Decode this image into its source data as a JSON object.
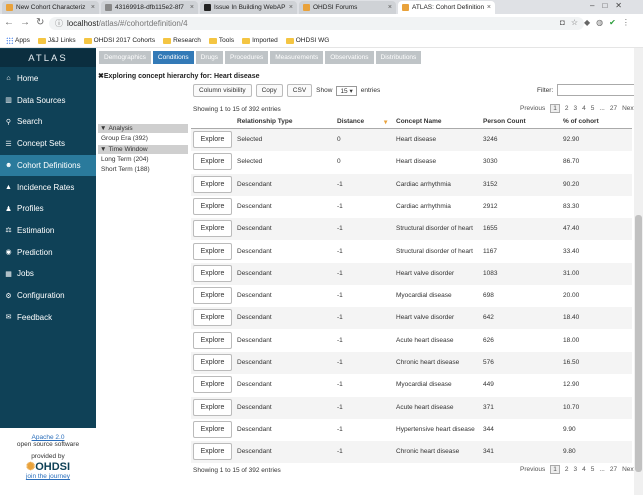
{
  "browser": {
    "tabs": [
      {
        "title": "New Cohort Characteriz",
        "color": "#e9a23b"
      },
      {
        "title": "43169918-dfb115e2-8f7",
        "color": "#888888"
      },
      {
        "title": "Issue In Building WebAP",
        "color": "#222222"
      },
      {
        "title": "OHDSI Forums",
        "color": "#e9a23b"
      },
      {
        "title": "ATLAS: Cohort Definition",
        "color": "#e9a23b"
      }
    ],
    "url_host": "localhost",
    "url_path": "/atlas/#/cohortdefinition/4",
    "bookmarks": [
      "Apps",
      "J&J Links",
      "OHDSI 2017 Cohorts",
      "Research",
      "Tools",
      "Imported",
      "OHDSI WG"
    ]
  },
  "sidebar": {
    "logo": "ATLAS",
    "items": [
      {
        "label": "Home",
        "icon": "⌂"
      },
      {
        "label": "Data Sources",
        "icon": "▥"
      },
      {
        "label": "Search",
        "icon": "⚲"
      },
      {
        "label": "Concept Sets",
        "icon": "☰"
      },
      {
        "label": "Cohort Definitions",
        "icon": "☻"
      },
      {
        "label": "Incidence Rates",
        "icon": "▲"
      },
      {
        "label": "Profiles",
        "icon": "♟"
      },
      {
        "label": "Estimation",
        "icon": "⚖"
      },
      {
        "label": "Prediction",
        "icon": "◉"
      },
      {
        "label": "Jobs",
        "icon": "▦"
      },
      {
        "label": "Configuration",
        "icon": "⚙"
      },
      {
        "label": "Feedback",
        "icon": "✉"
      }
    ],
    "active_index": 4,
    "footer": {
      "license": "Apache 2.0",
      "license_sub": "open source software",
      "provided_by": "provided by",
      "org": "OHDSI",
      "join": "join the journey"
    }
  },
  "main": {
    "tabs": [
      "Demographics",
      "Conditions",
      "Drugs",
      "Procedures",
      "Measurements",
      "Observations",
      "Distributions"
    ],
    "active_tab": 1,
    "hierarchy_title": "Exploring concept hierarchy for: Heart disease",
    "buttons": {
      "column_visibility": "Column visibility",
      "copy": "Copy",
      "csv": "CSV"
    },
    "show_label": "Show",
    "show_value": "15",
    "entries_label": "entries",
    "filter_label": "Filter:",
    "info": "Showing 1 to 15 of 392 entries",
    "pager": {
      "previous": "Previous",
      "pages": [
        "1",
        "2",
        "3",
        "4",
        "5",
        "...",
        "27"
      ],
      "next": "Next"
    },
    "filters": {
      "analysis_header": "Analysis",
      "analysis_items": [
        "Group Era (392)"
      ],
      "time_header": "Time Window",
      "time_items": [
        "Long Term (204)",
        "Short Term (188)"
      ]
    },
    "table": {
      "explore_label": "Explore",
      "columns": [
        "Relationship Type",
        "Distance",
        "Concept Name",
        "Person Count",
        "% of cohort"
      ],
      "rows": [
        [
          "Selected",
          "0",
          "Heart disease",
          "3246",
          "92.90"
        ],
        [
          "Selected",
          "0",
          "Heart disease",
          "3030",
          "86.70"
        ],
        [
          "Descendant",
          "-1",
          "Cardiac arrhythmia",
          "3152",
          "90.20"
        ],
        [
          "Descendant",
          "-1",
          "Cardiac arrhythmia",
          "2912",
          "83.30"
        ],
        [
          "Descendant",
          "-1",
          "Structural disorder of heart",
          "1655",
          "47.40"
        ],
        [
          "Descendant",
          "-1",
          "Structural disorder of heart",
          "1167",
          "33.40"
        ],
        [
          "Descendant",
          "-1",
          "Heart valve disorder",
          "1083",
          "31.00"
        ],
        [
          "Descendant",
          "-1",
          "Myocardial disease",
          "698",
          "20.00"
        ],
        [
          "Descendant",
          "-1",
          "Heart valve disorder",
          "642",
          "18.40"
        ],
        [
          "Descendant",
          "-1",
          "Acute heart disease",
          "626",
          "18.00"
        ],
        [
          "Descendant",
          "-1",
          "Chronic heart disease",
          "576",
          "16.50"
        ],
        [
          "Descendant",
          "-1",
          "Myocardial disease",
          "449",
          "12.90"
        ],
        [
          "Descendant",
          "-1",
          "Acute heart disease",
          "371",
          "10.70"
        ],
        [
          "Descendant",
          "-1",
          "Hypertensive heart disease",
          "344",
          "9.90"
        ],
        [
          "Descendant",
          "-1",
          "Chronic heart disease",
          "341",
          "9.80"
        ]
      ]
    }
  },
  "colors": {
    "sidebar": "#0f4157",
    "active_nav": "#2a7a9c",
    "active_tab": "#337ab7"
  }
}
